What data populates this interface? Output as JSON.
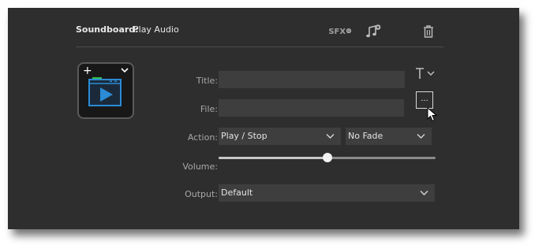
{
  "header": {
    "title_bold": "Soundboard:",
    "title_rest": "Play Audio",
    "sfx_label": "SFX",
    "sfx_plus": "⊕",
    "icons": [
      "sfx-add-icon",
      "music-add-icon",
      "trash-icon"
    ]
  },
  "thumbnail": {
    "plus": "+",
    "icons": [
      "plus-icon",
      "chevron-down-icon",
      "play-window-icon"
    ],
    "accent": "#2b8bd6",
    "progress_color": "#33c14a"
  },
  "form": {
    "title": {
      "label": "Title:",
      "value": ""
    },
    "file": {
      "label": "File:",
      "value": "",
      "browse_label": "..."
    },
    "action": {
      "label": "Action:",
      "selected": "Play / Stop",
      "fade_selected": "No Fade"
    },
    "volume": {
      "label": "Volume:",
      "level": 0.5
    },
    "output": {
      "label": "Output:",
      "selected": "Default"
    }
  },
  "colors": {
    "panel_bg": "#2e2e2e",
    "field_bg": "#3e3e3e",
    "text": "#e4e4e4",
    "label_text": "#a8a8a8"
  }
}
